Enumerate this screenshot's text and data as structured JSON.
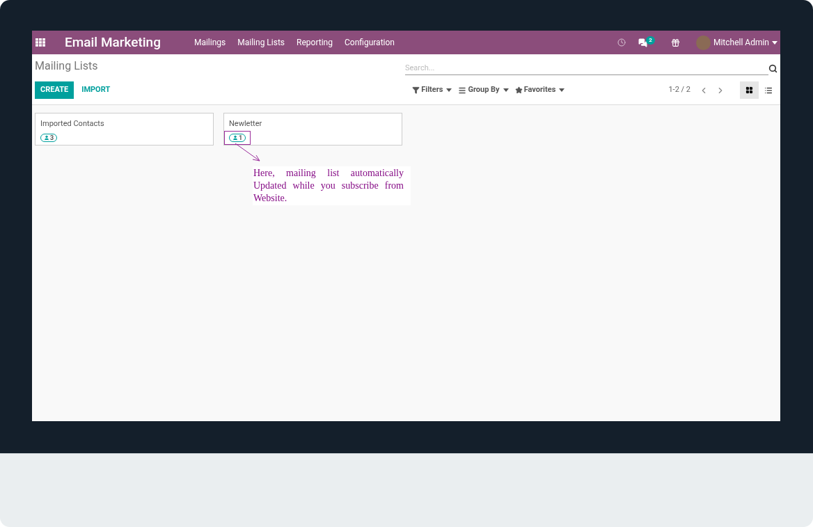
{
  "navbar": {
    "app_title": "Email Marketing",
    "menu": [
      "Mailings",
      "Mailing Lists",
      "Reporting",
      "Configuration"
    ],
    "messages_count": "2",
    "user": "Mitchell Admin"
  },
  "control_panel": {
    "breadcrumb": "Mailing Lists",
    "buttons": [
      {
        "label": "CREATE",
        "kind": "primary"
      },
      {
        "label": "IMPORT",
        "kind": "link"
      }
    ],
    "search": {
      "placeholder": "Search..."
    },
    "filters": [
      {
        "label": "Filters",
        "kind": "filter"
      },
      {
        "label": "Group By",
        "kind": "group"
      },
      {
        "label": "Favorites",
        "kind": "star"
      }
    ],
    "pager": "1-2 / 2",
    "views": [
      {
        "kind": "kanban",
        "selected": true
      },
      {
        "kind": "list",
        "selected": false
      }
    ]
  },
  "cards": [
    {
      "name": "Imported Contacts",
      "count": "3",
      "highlighted": false
    },
    {
      "name": "Newletter",
      "count": "1",
      "highlighted": true
    }
  ],
  "annotation": "Here, mailing list automatically Updated while you subscribe from Website."
}
